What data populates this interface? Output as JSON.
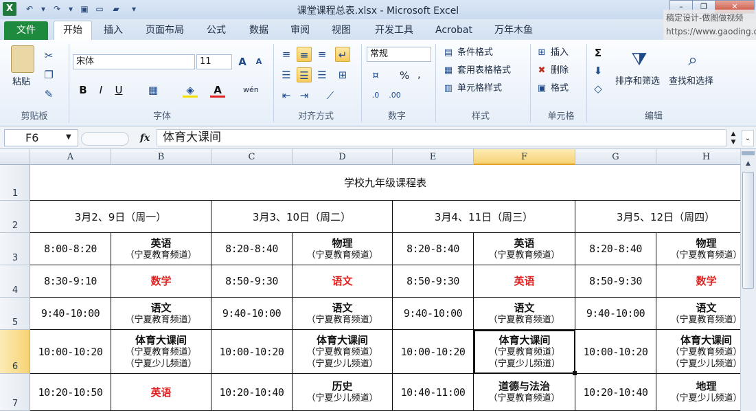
{
  "window": {
    "title": "课堂课程总表.xlsx - Microsoft Excel",
    "app_icon": "X"
  },
  "watermark": {
    "line1": "稿定设计-做图做视频",
    "line2": "https://www.gaoding.com"
  },
  "tabs": {
    "file": "文件",
    "home": "开始",
    "others": [
      "插入",
      "页面布局",
      "公式",
      "数据",
      "审阅",
      "视图",
      "开发工具",
      "Acrobat",
      "万年木鱼"
    ]
  },
  "ribbon": {
    "clipboard": {
      "paste": "粘贴",
      "label": "剪贴板"
    },
    "font": {
      "name": "宋体",
      "size": "11",
      "bold": "B",
      "italic": "I",
      "underline": "U",
      "label": "字体",
      "wen": "wén"
    },
    "align": {
      "label": "对齐方式"
    },
    "number": {
      "format": "常规",
      "label": "数字",
      "percent": "%",
      "comma": ","
    },
    "styles": {
      "cond": "条件格式",
      "table": "套用表格格式",
      "cell": "单元格样式",
      "label": "样式"
    },
    "cells": {
      "insert": "插入",
      "delete": "删除",
      "format": "格式",
      "label": "单元格"
    },
    "editing": {
      "sort": "排序和筛选",
      "find": "查找和选择",
      "label": "编辑"
    }
  },
  "formula_bar": {
    "name_box": "F6",
    "fx": "fx",
    "value": "体育大课间"
  },
  "columns": [
    "A",
    "B",
    "C",
    "D",
    "E",
    "F",
    "G",
    "H"
  ],
  "rows": [
    "1",
    "2",
    "3",
    "4",
    "5",
    "6",
    "7"
  ],
  "sheet": {
    "title": "学校九年级课程表",
    "days": [
      "3月2、9日（周一）",
      "3月3、10日（周二）",
      "3月4、11日（周三）",
      "3月5、12日（周四）"
    ],
    "r3": [
      "8:00-8:20",
      "英语",
      "（宁夏教育频道）",
      "8:20-8:40",
      "物理",
      "（宁夏教育频道）",
      "8:20-8:40",
      "英语",
      "（宁夏教育频道）",
      "8:20-8:40",
      "物理",
      "（宁夏教育频道）"
    ],
    "r4": [
      "8:30-9:10",
      "数学",
      "8:50-9:30",
      "语文",
      "8:50-9:30",
      "英语",
      "8:50-9:30",
      "数学"
    ],
    "r5": [
      "9:40-10:00",
      "语文",
      "（宁夏教育频道）",
      "9:40-10:00",
      "语文",
      "（宁夏教育频道）",
      "9:40-10:00",
      "语文",
      "（宁夏教育频道）",
      "9:40-10:00",
      "语文",
      "（宁夏教育频道）"
    ],
    "r6": [
      "10:00-10:20",
      "体育大课间",
      "（宁夏教育频道）",
      "（宁夏少儿频道）",
      "10:00-10:20",
      "体育大课间",
      "（宁夏教育频道）",
      "（宁夏少儿频道）",
      "10:00-10:20",
      "体育大课间",
      "（宁夏教育频道）",
      "（宁夏少儿频道）",
      "10:00-10:20",
      "体育大课间",
      "（宁夏教育频道）",
      "（宁夏少儿频道）"
    ],
    "r7": [
      "10:20-10:50",
      "英语",
      "10:20-10:40",
      "历史",
      "（宁夏少儿频道）",
      "10:40-11:00",
      "道德与法治",
      "（宁夏教育频道）",
      "10:20-10:40",
      "地理",
      "（宁夏少儿频道）"
    ]
  },
  "colors": {
    "accent_red": "#e02020",
    "file_tab": "#1e8a3e",
    "selection": "#f7d374"
  }
}
